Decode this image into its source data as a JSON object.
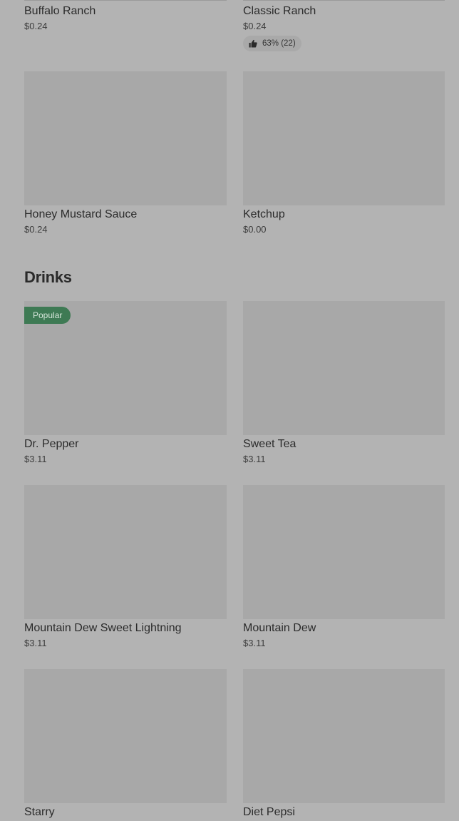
{
  "sauces": {
    "items": [
      {
        "name": "Buffalo Ranch",
        "price": "$0.24"
      },
      {
        "name": "Classic Ranch",
        "price": "$0.24",
        "rating": "63% (22)"
      },
      {
        "name": "Honey Mustard Sauce",
        "price": "$0.24"
      },
      {
        "name": "Ketchup",
        "price": "$0.00"
      }
    ]
  },
  "drinks": {
    "title": "Drinks",
    "badge": "Popular",
    "items": [
      {
        "name": "Dr. Pepper",
        "price": "$3.11"
      },
      {
        "name": "Sweet Tea",
        "price": "$3.11"
      },
      {
        "name": "Mountain Dew Sweet Lightning",
        "price": "$3.11"
      },
      {
        "name": "Mountain Dew",
        "price": "$3.11"
      },
      {
        "name": "Starry"
      },
      {
        "name": "Diet Pepsi"
      }
    ]
  },
  "icons": {
    "rating": "thumbs-up-icon"
  },
  "colors": {
    "overlay_background": "#b3b3b3",
    "image_placeholder": "#a8a8a8",
    "popular_badge": "#3e7a54"
  }
}
